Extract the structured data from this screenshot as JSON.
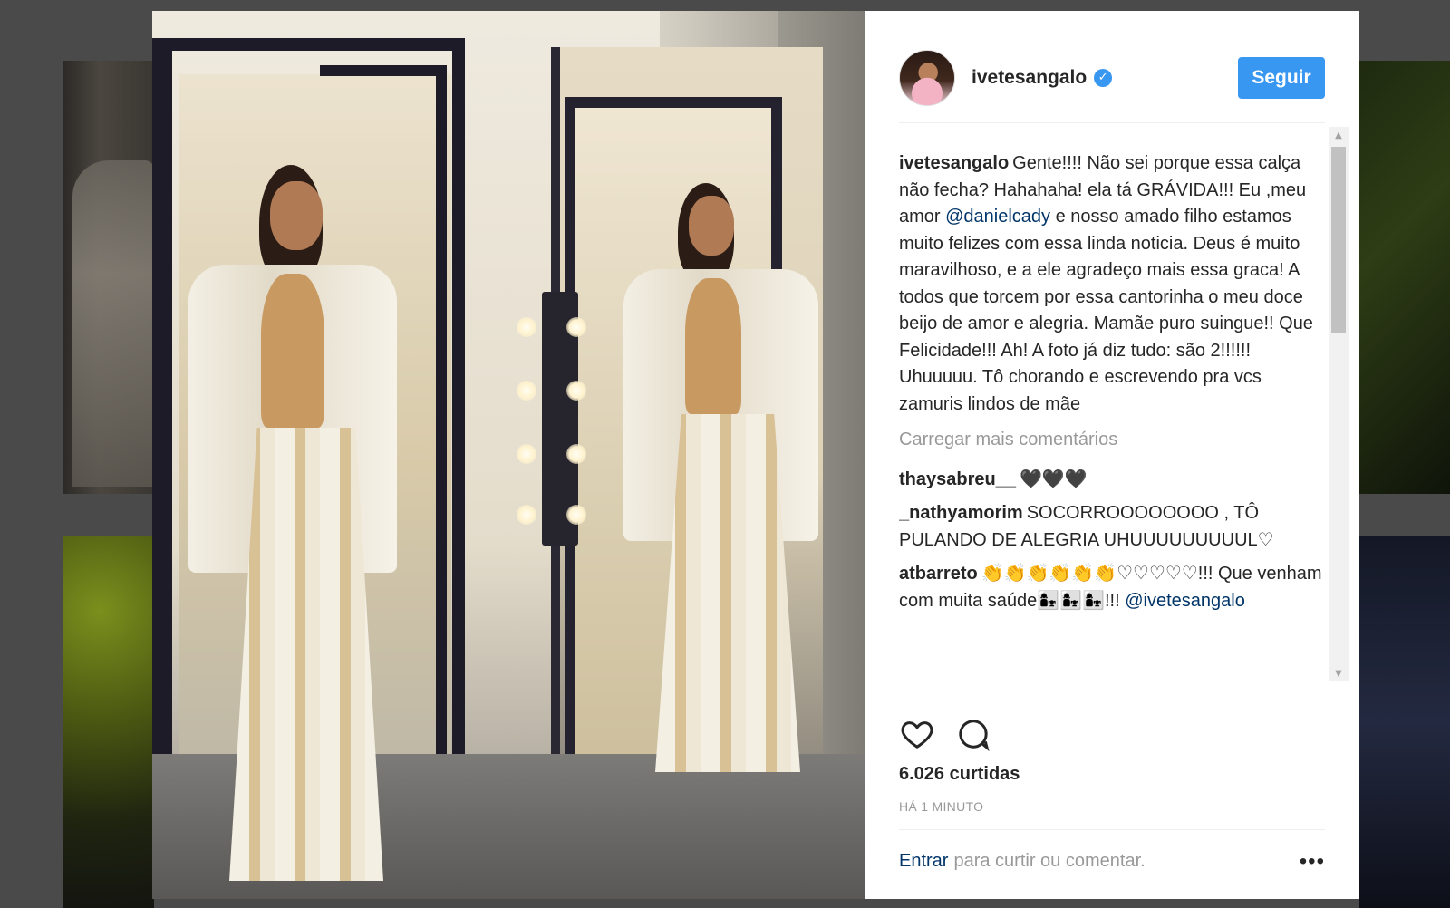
{
  "post": {
    "username": "ivetesangalo",
    "follow_label": "Seguir",
    "caption": {
      "author": "ivetesangalo",
      "text_before_mention": "Gente!!!! Não sei porque essa calça não fecha? Hahahaha! ela tá GRÁVIDA!!! Eu ,meu amor ",
      "mention": "@danielcady",
      "text_after_mention": " e nosso amado filho estamos muito felizes com essa linda noticia. Deus é muito maravilhoso, e a ele agradeço mais essa graca! A todos que torcem por essa cantorinha o meu doce beijo de amor e alegria. Mamãe puro suingue!! Que Felicidade!!! Ah! A foto já diz tudo: são 2!!!!!! Uhuuuuu. Tô chorando e escrevendo pra vcs zamuris lindos de mãe"
    },
    "load_more_label": "Carregar mais comentários",
    "comments": [
      {
        "author": "thaysabreu__",
        "text": "🖤🖤🖤"
      },
      {
        "author": "_nathyamorim",
        "text": "SOCORROOOOOOOO , TÔ PULANDO DE ALEGRIA UHUUUUUUUUUL♡"
      },
      {
        "author": "atbarreto",
        "text": "👏👏👏👏👏👏♡♡♡♡♡!!! Que venham com muita saúde👩‍👧👩‍👧👩‍👧!!! ",
        "mention": "@ivetesangalo"
      }
    ],
    "likes_label": "6.026 curtidas",
    "timestamp": "HÁ 1 MINUTO",
    "login_link": "Entrar",
    "login_text": "para curtir ou comentar.",
    "more_label": "•••"
  },
  "icons": {
    "like": "heart-icon",
    "comment": "comment-icon",
    "verified": "verified-badge-icon",
    "more": "more-options-icon"
  },
  "colors": {
    "accent": "#3897f0",
    "mention": "#003569",
    "muted": "#999999",
    "text": "#262626",
    "backdrop": "#4a4a4a"
  }
}
